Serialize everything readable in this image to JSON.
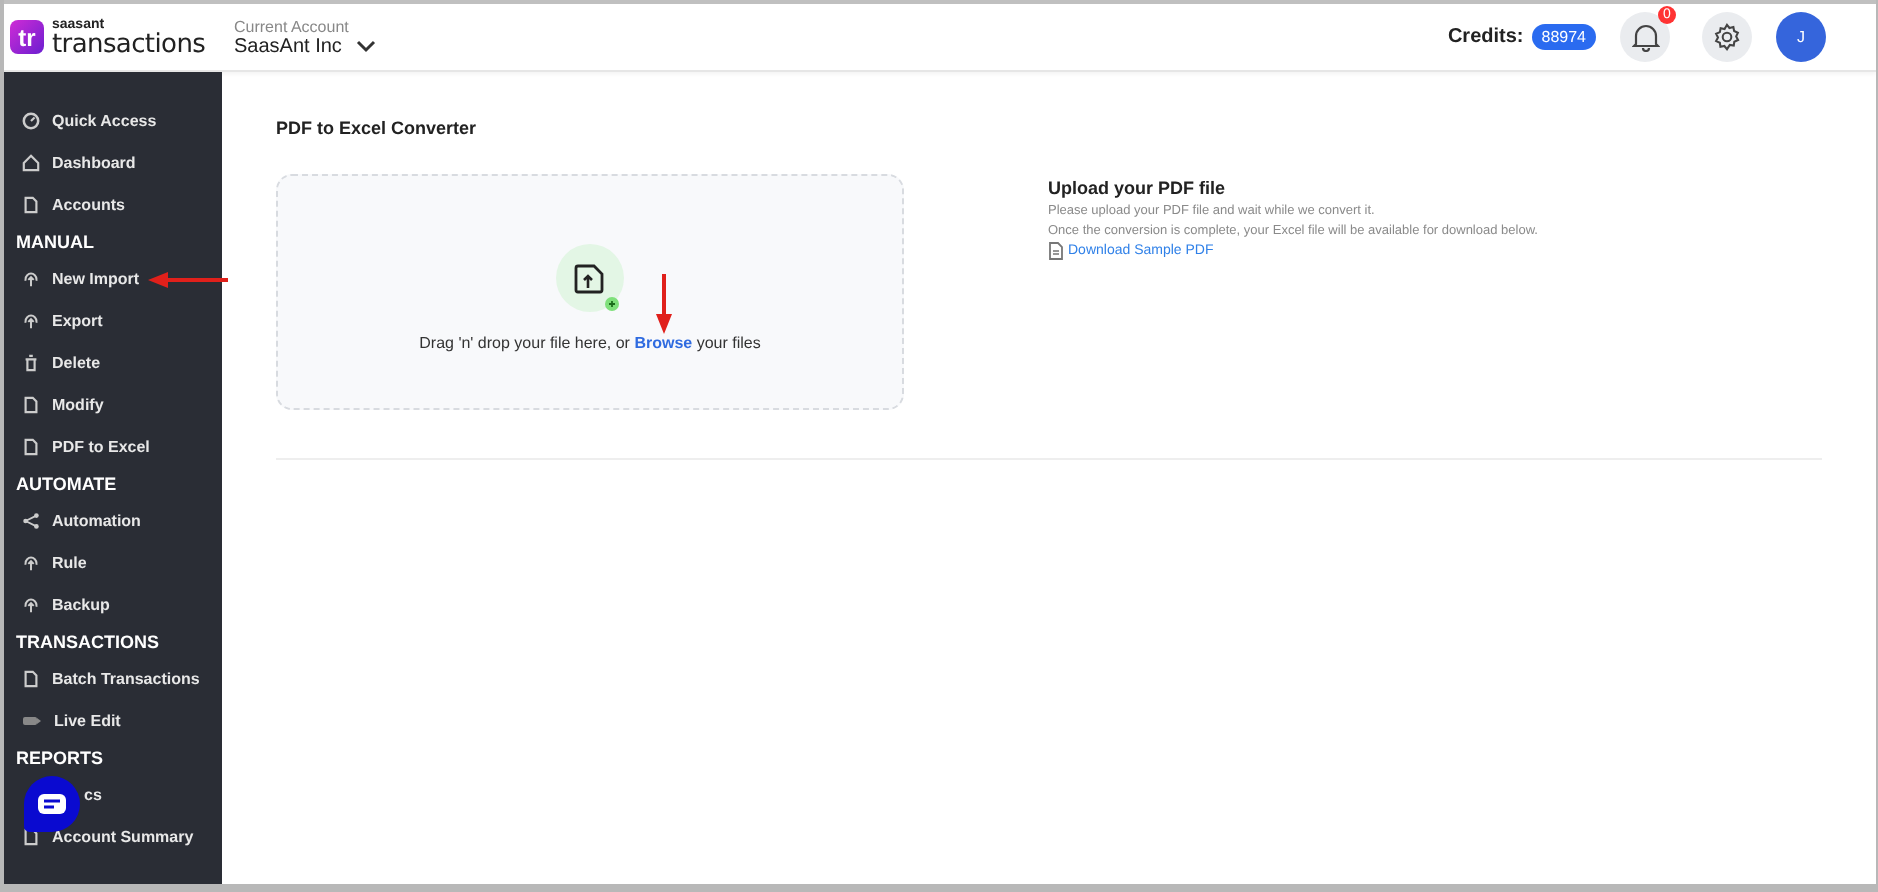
{
  "brand": {
    "logo": "tr",
    "small": "saasant",
    "name": "transactions"
  },
  "account": {
    "label": "Current Account",
    "value": "SaasAnt Inc"
  },
  "header": {
    "credits_label": "Credits:",
    "credits": "88974",
    "notifications": "0",
    "avatar": "J"
  },
  "sidebar": [
    {
      "kind": "item",
      "label": "Quick Access",
      "pointed": false
    },
    {
      "kind": "item",
      "label": "Dashboard",
      "pointed": false
    },
    {
      "kind": "item",
      "label": "Accounts",
      "pointed": false
    },
    {
      "kind": "section",
      "label": "MANUAL"
    },
    {
      "kind": "item",
      "label": "New Import",
      "pointed": true
    },
    {
      "kind": "item",
      "label": "Export",
      "pointed": false
    },
    {
      "kind": "item",
      "label": "Delete",
      "pointed": false
    },
    {
      "kind": "item",
      "label": "Modify",
      "pointed": false
    },
    {
      "kind": "item",
      "label": "PDF to Excel",
      "pointed": false
    },
    {
      "kind": "section",
      "label": "AUTOMATE"
    },
    {
      "kind": "item",
      "label": "Automation",
      "pointed": false
    },
    {
      "kind": "item",
      "label": "Rule",
      "pointed": false
    },
    {
      "kind": "item",
      "label": "Backup",
      "pointed": false
    },
    {
      "kind": "section",
      "label": "TRANSACTIONS"
    },
    {
      "kind": "item",
      "label": "Batch Transactions",
      "pointed": false
    },
    {
      "kind": "item",
      "label": "Live Edit",
      "pointed": false
    },
    {
      "kind": "section",
      "label": "REPORTS"
    },
    {
      "kind": "covered",
      "label": "cs",
      "pointed": false
    },
    {
      "kind": "item",
      "label": "Account Summary",
      "pointed": false
    }
  ],
  "page": {
    "title": "PDF to Excel Converter",
    "dropzone": {
      "before": "Drag 'n' drop your file here, or",
      "link": "Browse",
      "after": "your files"
    },
    "info": {
      "title": "Upload your PDF file",
      "lines": [
        "Please upload your PDF file and wait while we convert it.",
        "Once the conversion is complete, your Excel file will be available for download below."
      ],
      "link": "Download Sample PDF"
    }
  }
}
